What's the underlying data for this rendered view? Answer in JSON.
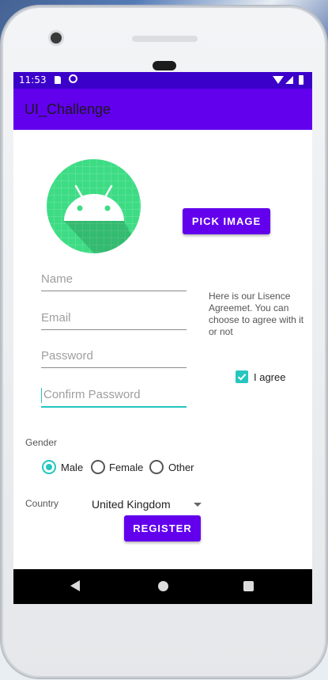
{
  "status_bar": {
    "time": "11:53"
  },
  "app_bar": {
    "title": "UI_Challenge"
  },
  "buttons": {
    "pick_image": "PICK IMAGE",
    "register": "REGISTER"
  },
  "form": {
    "name_placeholder": "Name",
    "email_placeholder": "Email",
    "password_placeholder": "Password",
    "confirm_password_placeholder": "Confirm Password"
  },
  "license": {
    "text": "Here is our Lisence Agreemet. You can choose to agree with it or not",
    "agree_label": "I agree",
    "agree_checked": true
  },
  "gender": {
    "label": "Gender",
    "options": [
      "Male",
      "Female",
      "Other"
    ],
    "selected": "Male"
  },
  "country": {
    "label": "Country",
    "selected": "United Kingdom"
  },
  "colors": {
    "primary": "#6200ee",
    "status_bar": "#3b00c9",
    "accent": "#26c6bf",
    "avatar_green": "#3ddc84"
  },
  "icons": {
    "status": [
      "sd-card-icon",
      "sync-icon",
      "wifi-icon",
      "signal-icon",
      "battery-icon"
    ],
    "nav": [
      "back-icon",
      "home-icon",
      "recents-icon"
    ]
  }
}
